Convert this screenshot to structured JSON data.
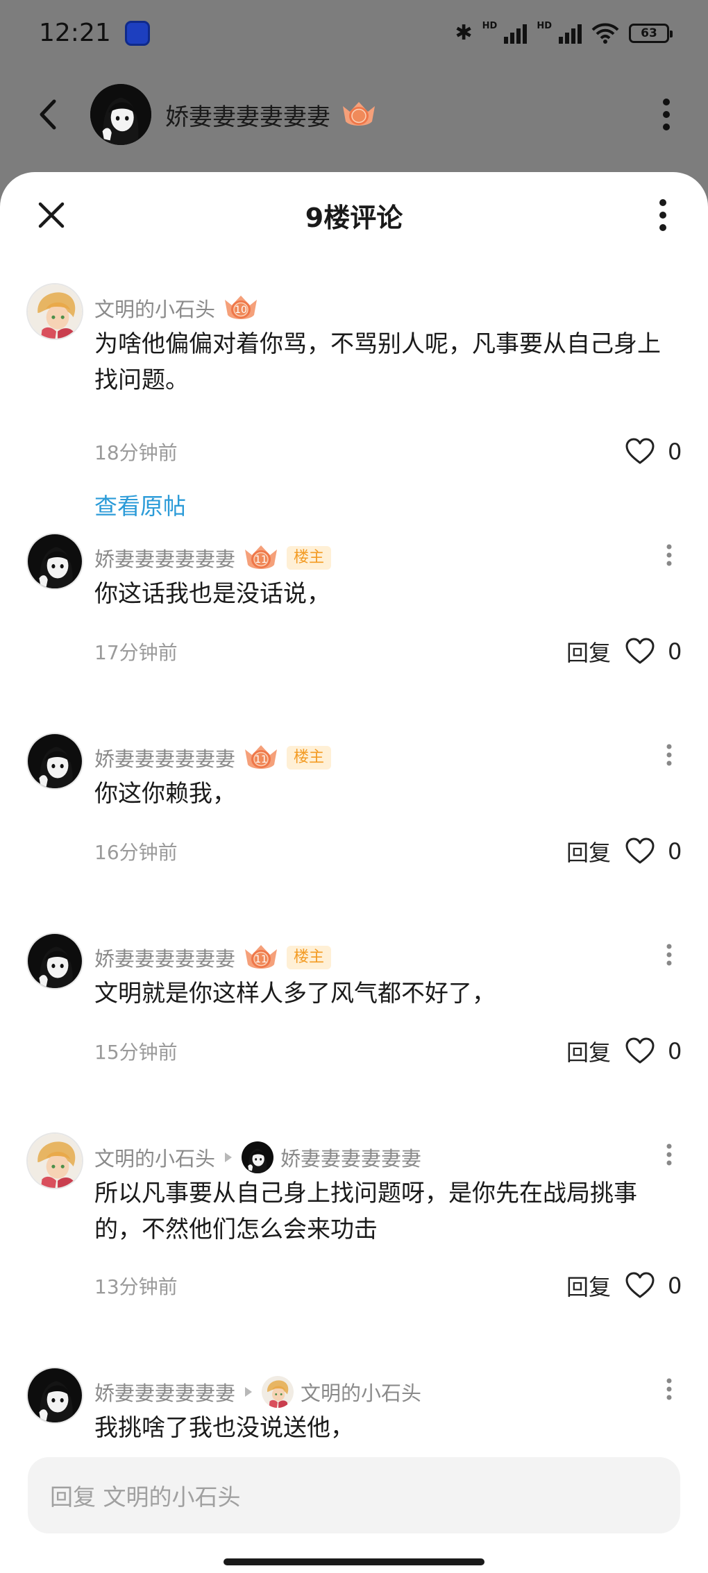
{
  "status": {
    "time": "12:21",
    "hd1": "HD",
    "hd2": "HD",
    "battery": "63"
  },
  "topbar": {
    "name": "娇妻妻妻妻妻妻",
    "level": "11"
  },
  "sheet": {
    "title": "9楼评论"
  },
  "main_comment": {
    "user": "文明的小石头",
    "level": "10",
    "text": "为啥他偏偏对着你骂，不骂别人呢，凡事要从自己身上找问题。",
    "time": "18分钟前",
    "likes": "0",
    "view_post": "查看原帖"
  },
  "replies": [
    {
      "user": "娇妻妻妻妻妻妻",
      "level": "11",
      "tag": "楼主",
      "text": "你这话我也是没话说，",
      "time": "17分钟前",
      "reply_label": "回复",
      "likes": "0"
    },
    {
      "user": "娇妻妻妻妻妻妻",
      "level": "11",
      "tag": "楼主",
      "text": "你这你赖我，",
      "time": "16分钟前",
      "reply_label": "回复",
      "likes": "0"
    },
    {
      "user": "娇妻妻妻妻妻妻",
      "level": "11",
      "tag": "楼主",
      "text": "文明就是你这样人多了风气都不好了，",
      "time": "15分钟前",
      "reply_label": "回复",
      "likes": "0"
    },
    {
      "user": "文明的小石头",
      "reply_to": "娇妻妻妻妻妻妻",
      "text": "所以凡事要从自己身上找问题呀，是你先在战局挑事的，不然他们怎么会来功击",
      "time": "13分钟前",
      "reply_label": "回复",
      "likes": "0"
    },
    {
      "user": "娇妻妻妻妻妻妻",
      "reply_to": "文明的小石头",
      "text": "我挑啥了我也没说送他，"
    }
  ],
  "input": {
    "placeholder": "回复 文明的小石头"
  },
  "colors": {
    "accent_link": "#2b9bd8",
    "owner_tag": "#f39b23",
    "level_badge": "#f07d56"
  }
}
